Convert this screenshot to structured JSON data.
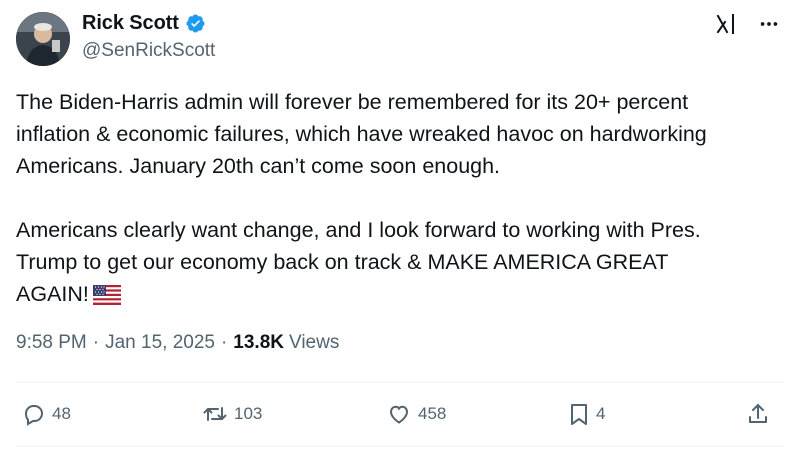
{
  "author": {
    "display_name": "Rick Scott",
    "handle": "@SenRickScott",
    "verified": true
  },
  "tweet": {
    "paragraph1_lines": [
      "The Biden-Harris admin will forever be remembered for its 20+ percent",
      "inflation & economic failures, which have wreaked havoc on hardworking",
      "Americans. January 20th can’t come soon enough."
    ],
    "paragraph2_lines": [
      "Americans clearly want change, and I look forward to working with Pres.",
      "Trump to get our economy back on track & MAKE AMERICA GREAT",
      "AGAIN!"
    ],
    "emoji": "us-flag-emoji"
  },
  "meta": {
    "time": "9:58 PM",
    "separator": "·",
    "date": "Jan 15, 2025",
    "views_count": "13.8K",
    "views_label": "Views"
  },
  "actions": {
    "replies": "48",
    "reposts": "103",
    "likes": "458",
    "bookmarks": "4"
  },
  "icons": {
    "verified": "verified-badge-icon",
    "grok": "grok-icon",
    "more": "more-icon",
    "reply": "reply-icon",
    "repost": "repost-icon",
    "like": "heart-icon",
    "bookmark": "bookmark-icon",
    "share": "share-icon"
  },
  "colors": {
    "text": "#0f1419",
    "secondary": "#536471",
    "verified_blue": "#1d9bf0",
    "divider": "#eff3f4"
  }
}
